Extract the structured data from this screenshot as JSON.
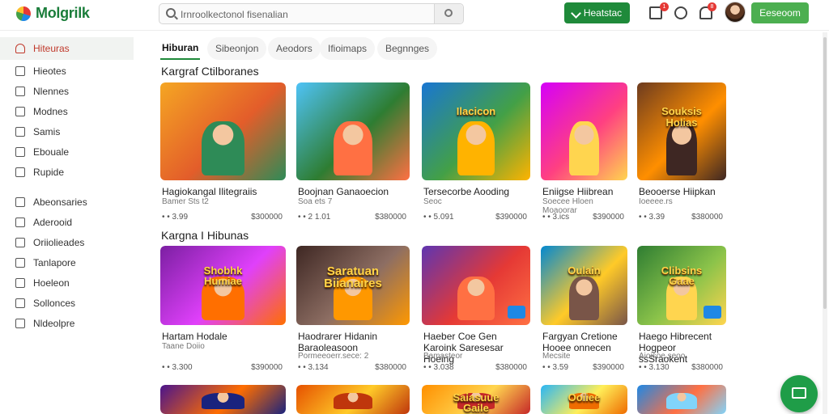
{
  "header": {
    "logo_text": "Molgrilk",
    "search_placeholder": "Irnroolkectonol fisenalian",
    "primary_button": "Heatstac",
    "secondary_button": "Eeseoom",
    "badges": [
      "1",
      "8"
    ]
  },
  "sidebar": {
    "items": [
      {
        "label": "Hiteuras",
        "icon": "home-icon",
        "active": true
      },
      {
        "label": "Hieotes",
        "icon": "list-icon"
      },
      {
        "label": "Nlennes",
        "icon": "box-icon"
      },
      {
        "label": "Modnes",
        "icon": "square-icon"
      },
      {
        "label": "Samis",
        "icon": "doc-icon"
      },
      {
        "label": "Ebouale",
        "icon": "diamond-icon"
      },
      {
        "label": "Rupide",
        "icon": "circle-icon"
      },
      {
        "label": "Abeonsaries",
        "icon": "gift-icon"
      },
      {
        "label": "Aderooid",
        "icon": "bag-icon"
      },
      {
        "label": "Oriiolieades",
        "icon": "folder-icon"
      },
      {
        "label": "Tanlapore",
        "icon": "tag-icon"
      },
      {
        "label": "Hoeleon",
        "icon": "image-icon"
      },
      {
        "label": "Sollonces",
        "icon": "calendar-icon"
      },
      {
        "label": "Nldeolpre",
        "icon": "book-icon"
      }
    ]
  },
  "tabs": [
    "Hiburan",
    "Sibeonjon",
    "Aeodors",
    "Ifioimaps",
    "Begnnges"
  ],
  "sections": [
    {
      "title": "Kargraf Ctilboranes",
      "cards": [
        {
          "title": "Hagiokangal Ilitegraiis",
          "sub": "Bamer Sts t2",
          "rating": "• • 3.99",
          "price": "$300000",
          "colors": [
            "#f5a623",
            "#e35d2a",
            "#2e8b57"
          ],
          "art": ""
        },
        {
          "title": "Boojnan Ganaoecion",
          "sub": "Soa ets  7",
          "rating": "• • 2 1.01",
          "price": "$380000",
          "colors": [
            "#4fc3f7",
            "#2e7d32",
            "#ff7043"
          ],
          "art": ""
        },
        {
          "title": "Tersecorbe Aooding",
          "sub": "Seoc",
          "rating": "• • 5.091",
          "price": "$390000",
          "colors": [
            "#1976d2",
            "#43a047",
            "#ffb300"
          ],
          "art": "Ilacicon"
        },
        {
          "title": "Eniigse Hiibrean",
          "sub": "Soecee Hloen Moaoorar",
          "rating": "• • 3.ics",
          "price": "$390000",
          "colors": [
            "#d500f9",
            "#ff4081",
            "#ffd54f"
          ],
          "art": ""
        },
        {
          "title": "Beooerse Hiipkan",
          "sub": "Ioeeee.rs",
          "rating": "• • 3.39",
          "price": "$380000",
          "colors": [
            "#6d3b1f",
            "#ff8f00",
            "#3e2723"
          ],
          "art": "Souksis Holias"
        }
      ]
    },
    {
      "title": "Kargna I Hibunas",
      "cards": [
        {
          "title": "Hartam Hodale",
          "sub": "Taane Doiio",
          "rating": "• • 3.300",
          "price": "$390000",
          "colors": [
            "#7b1fa2",
            "#e040fb",
            "#ff6f00"
          ],
          "art": "Shobhk Humiae"
        },
        {
          "title": "Haodrarer Hidanin Baraoleasoon",
          "sub": "Pormeeoerr.sece: 2",
          "rating": "• • 3.134",
          "price": "$380000",
          "colors": [
            "#3e2723",
            "#8d6e63",
            "#ff9800"
          ],
          "art": "Saratuan Biianaires"
        },
        {
          "title": "Haeber Coe Gen Karoink Saresesar Hoeing",
          "sub": "Bamasteor",
          "rating": "• • 3.038",
          "price": "$380000",
          "colors": [
            "#5e35b1",
            "#e53935",
            "#ff7043"
          ],
          "art": ""
        },
        {
          "title": "Fargyan Cretione Hooee onnecen",
          "sub": "Mecsite",
          "rating": "• • 3.59",
          "price": "$390000",
          "colors": [
            "#0288d1",
            "#ffca28",
            "#795548"
          ],
          "art": "Oulain"
        },
        {
          "title": "Haego Hibrecent Hogpeor ssSraokent",
          "sub": "Aioisoe seoo",
          "rating": "• • 3.130",
          "price": "$380000",
          "colors": [
            "#2e7d32",
            "#8bc34a",
            "#ffd54f"
          ],
          "art": "Clibsins Gaae"
        }
      ]
    },
    {
      "title": "",
      "cards": [
        {
          "title": "",
          "sub": "",
          "rating": "",
          "price": "",
          "colors": [
            "#4a148c",
            "#ff6d00",
            "#1a237e"
          ],
          "art": ""
        },
        {
          "title": "",
          "sub": "",
          "rating": "",
          "price": "",
          "colors": [
            "#e65100",
            "#ffca28",
            "#bf360c"
          ],
          "art": ""
        },
        {
          "title": "",
          "sub": "",
          "rating": "",
          "price": "",
          "colors": [
            "#ff8f00",
            "#ffd54f",
            "#c62828"
          ],
          "art": "Saiasuue Gaile"
        },
        {
          "title": "",
          "sub": "",
          "rating": "",
          "price": "",
          "colors": [
            "#29b6f6",
            "#ffee58",
            "#ef6c00"
          ],
          "art": "Ooiiee"
        },
        {
          "title": "",
          "sub": "",
          "rating": "",
          "price": "",
          "colors": [
            "#1e88e5",
            "#ff7043",
            "#81d4fa"
          ],
          "art": ""
        }
      ]
    }
  ]
}
